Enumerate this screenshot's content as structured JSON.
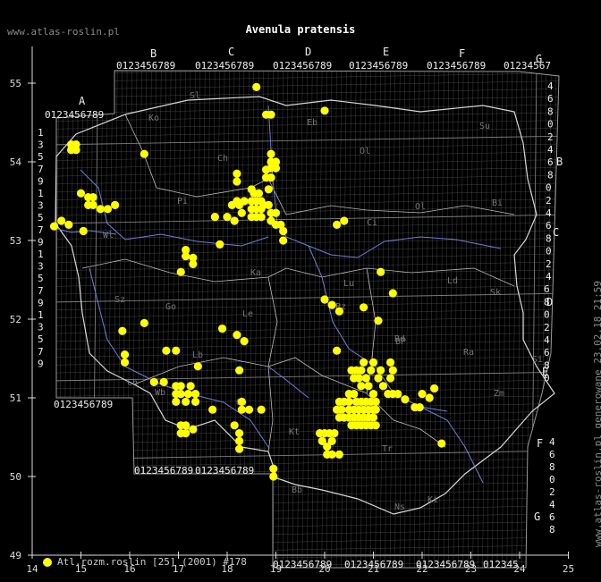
{
  "title": "Avenula pratensis",
  "site": "www.atlas-roslin.pl",
  "generated": "www.atlas-roslin.pl generowane 23.02.18 21:59",
  "legend": {
    "label": "Atl.rozm.roslin [25] (2001) #178",
    "color": "#ffff00"
  },
  "axes": {
    "x_ticks": [
      "14",
      "15",
      "16",
      "17",
      "18",
      "19",
      "20",
      "21",
      "22",
      "23",
      "24",
      "25"
    ],
    "y_ticks": [
      "55",
      "54",
      "53",
      "52",
      "51",
      "50",
      "49"
    ]
  },
  "grid_letters_top": [
    "A",
    "B",
    "C",
    "D",
    "E",
    "F",
    "G"
  ],
  "grid_letters_right": [
    "B",
    "C",
    "D",
    "E",
    "F",
    "G"
  ],
  "digits_row": "0123456789",
  "region_codes": [
    "Sl",
    "Ko",
    "Eb",
    "Su",
    "Ol",
    "Ch",
    "Pi",
    "Bi",
    "Ci",
    "Wl",
    "Ka",
    "Ol",
    "Sz",
    "Go",
    "Le",
    "Pz",
    "Lu",
    "Ld",
    "Sk",
    "Si",
    "BP",
    "Ra",
    "Lb",
    "Ch",
    "Wb",
    "Op",
    "Kt",
    "Rd",
    "Zm",
    "Tr",
    "Ns",
    "Ki",
    "Bb"
  ],
  "colors": {
    "background": "#000000",
    "grid": "#8a8a8a",
    "border": "#d8d8d8",
    "river": "#6f7fd8",
    "dot": "#ffff00"
  },
  "chart_data": {
    "type": "scatter",
    "title": "Avenula pratensis",
    "xlim": [
      14,
      25
    ],
    "ylim": [
      49,
      55.5
    ],
    "series": [
      {
        "name": "Atl.rozm.roslin [25] (2001) #178",
        "points": [
          [
            18.6,
            54.95
          ],
          [
            18.9,
            54.6
          ],
          [
            20.0,
            54.65
          ],
          [
            18.8,
            54.6
          ],
          [
            14.8,
            54.22
          ],
          [
            14.9,
            54.22
          ],
          [
            14.8,
            54.15
          ],
          [
            14.9,
            54.15
          ],
          [
            16.3,
            54.1
          ],
          [
            18.9,
            54.1
          ],
          [
            18.9,
            54.0
          ],
          [
            19.0,
            54.0
          ],
          [
            18.9,
            53.92
          ],
          [
            19.0,
            53.92
          ],
          [
            18.2,
            53.85
          ],
          [
            18.2,
            53.75
          ],
          [
            18.8,
            53.9
          ],
          [
            18.8,
            53.8
          ],
          [
            18.9,
            53.8
          ],
          [
            15.0,
            53.6
          ],
          [
            15.15,
            53.55
          ],
          [
            15.25,
            53.55
          ],
          [
            15.25,
            53.45
          ],
          [
            15.15,
            53.45
          ],
          [
            15.4,
            53.4
          ],
          [
            15.55,
            53.4
          ],
          [
            15.7,
            53.45
          ],
          [
            14.45,
            53.18
          ],
          [
            14.6,
            53.25
          ],
          [
            14.75,
            53.2
          ],
          [
            15.05,
            53.12
          ],
          [
            18.1,
            53.45
          ],
          [
            18.2,
            53.5
          ],
          [
            18.25,
            53.45
          ],
          [
            18.35,
            53.5
          ],
          [
            18.5,
            53.65
          ],
          [
            18.55,
            53.6
          ],
          [
            18.65,
            53.6
          ],
          [
            18.5,
            53.5
          ],
          [
            18.6,
            53.5
          ],
          [
            18.7,
            53.5
          ],
          [
            18.5,
            53.4
          ],
          [
            18.6,
            53.4
          ],
          [
            18.7,
            53.4
          ],
          [
            18.6,
            53.3
          ],
          [
            18.7,
            53.3
          ],
          [
            18.85,
            53.65
          ],
          [
            18.75,
            53.45
          ],
          [
            18.85,
            53.45
          ],
          [
            18.9,
            53.35
          ],
          [
            19.0,
            53.35
          ],
          [
            18.9,
            53.25
          ],
          [
            19.0,
            53.2
          ],
          [
            19.1,
            53.2
          ],
          [
            19.15,
            53.12
          ],
          [
            19.15,
            53.0
          ],
          [
            17.75,
            53.3
          ],
          [
            18.0,
            53.3
          ],
          [
            18.15,
            53.25
          ],
          [
            18.3,
            53.35
          ],
          [
            18.5,
            53.3
          ],
          [
            17.85,
            52.95
          ],
          [
            17.15,
            52.88
          ],
          [
            17.15,
            52.8
          ],
          [
            17.3,
            52.78
          ],
          [
            17.3,
            52.7
          ],
          [
            17.05,
            52.6
          ],
          [
            20.25,
            53.2
          ],
          [
            20.4,
            53.25
          ],
          [
            21.15,
            52.6
          ],
          [
            21.4,
            52.33
          ],
          [
            20.0,
            52.25
          ],
          [
            20.15,
            52.18
          ],
          [
            20.3,
            52.1
          ],
          [
            20.8,
            52.15
          ],
          [
            21.1,
            51.98
          ],
          [
            16.3,
            51.95
          ],
          [
            15.85,
            51.85
          ],
          [
            17.9,
            51.88
          ],
          [
            18.2,
            51.8
          ],
          [
            18.35,
            51.72
          ],
          [
            15.9,
            51.55
          ],
          [
            15.9,
            51.45
          ],
          [
            16.75,
            51.6
          ],
          [
            16.95,
            51.6
          ],
          [
            17.4,
            51.4
          ],
          [
            18.25,
            51.35
          ],
          [
            20.25,
            51.6
          ],
          [
            16.5,
            51.2
          ],
          [
            16.7,
            51.2
          ],
          [
            16.95,
            51.15
          ],
          [
            17.05,
            51.15
          ],
          [
            17.25,
            51.15
          ],
          [
            16.95,
            51.05
          ],
          [
            17.05,
            51.05
          ],
          [
            17.2,
            51.05
          ],
          [
            17.35,
            51.05
          ],
          [
            16.95,
            50.95
          ],
          [
            17.15,
            50.95
          ],
          [
            17.35,
            50.95
          ],
          [
            17.7,
            50.85
          ],
          [
            17.05,
            50.65
          ],
          [
            17.15,
            50.65
          ],
          [
            17.3,
            50.6
          ],
          [
            17.05,
            50.55
          ],
          [
            17.15,
            50.55
          ],
          [
            18.3,
            50.95
          ],
          [
            18.3,
            50.85
          ],
          [
            18.45,
            50.85
          ],
          [
            18.7,
            50.85
          ],
          [
            18.15,
            50.65
          ],
          [
            18.25,
            50.55
          ],
          [
            18.25,
            50.45
          ],
          [
            18.25,
            50.35
          ],
          [
            20.8,
            51.45
          ],
          [
            21.0,
            51.45
          ],
          [
            21.35,
            51.45
          ],
          [
            20.55,
            51.35
          ],
          [
            20.65,
            51.35
          ],
          [
            20.75,
            51.35
          ],
          [
            20.95,
            51.35
          ],
          [
            21.15,
            51.35
          ],
          [
            21.4,
            51.35
          ],
          [
            20.6,
            51.25
          ],
          [
            20.7,
            51.25
          ],
          [
            20.85,
            51.25
          ],
          [
            21.1,
            51.25
          ],
          [
            21.35,
            51.25
          ],
          [
            20.75,
            51.15
          ],
          [
            20.9,
            51.15
          ],
          [
            21.2,
            51.15
          ],
          [
            21.3,
            51.05
          ],
          [
            21.4,
            51.05
          ],
          [
            21.5,
            51.05
          ],
          [
            20.5,
            51.05
          ],
          [
            20.6,
            51.05
          ],
          [
            21.0,
            51.05
          ],
          [
            21.65,
            50.98
          ],
          [
            21.85,
            50.88
          ],
          [
            21.95,
            50.88
          ],
          [
            22.0,
            51.05
          ],
          [
            22.15,
            51.0
          ],
          [
            22.25,
            51.12
          ],
          [
            20.3,
            50.95
          ],
          [
            20.4,
            50.95
          ],
          [
            20.5,
            50.95
          ],
          [
            20.65,
            50.95
          ],
          [
            20.75,
            50.95
          ],
          [
            20.85,
            50.95
          ],
          [
            20.95,
            50.95
          ],
          [
            21.05,
            50.95
          ],
          [
            20.25,
            50.85
          ],
          [
            20.35,
            50.85
          ],
          [
            20.5,
            50.85
          ],
          [
            20.6,
            50.85
          ],
          [
            20.7,
            50.85
          ],
          [
            20.8,
            50.85
          ],
          [
            20.9,
            50.85
          ],
          [
            21.0,
            50.85
          ],
          [
            21.05,
            50.85
          ],
          [
            20.3,
            50.75
          ],
          [
            20.4,
            50.75
          ],
          [
            20.5,
            50.75
          ],
          [
            20.6,
            50.75
          ],
          [
            20.7,
            50.75
          ],
          [
            20.8,
            50.75
          ],
          [
            20.9,
            50.75
          ],
          [
            21.0,
            50.75
          ],
          [
            20.55,
            50.65
          ],
          [
            20.65,
            50.65
          ],
          [
            20.75,
            50.65
          ],
          [
            20.85,
            50.65
          ],
          [
            20.95,
            50.65
          ],
          [
            21.05,
            50.65
          ],
          [
            19.9,
            50.55
          ],
          [
            20.0,
            50.55
          ],
          [
            20.1,
            50.55
          ],
          [
            20.2,
            50.55
          ],
          [
            19.95,
            50.45
          ],
          [
            20.15,
            50.45
          ],
          [
            20.05,
            50.38
          ],
          [
            20.05,
            50.28
          ],
          [
            20.15,
            50.28
          ],
          [
            20.3,
            50.28
          ],
          [
            22.4,
            50.42
          ],
          [
            18.95,
            50.1
          ],
          [
            18.95,
            50.0
          ]
        ]
      }
    ]
  }
}
